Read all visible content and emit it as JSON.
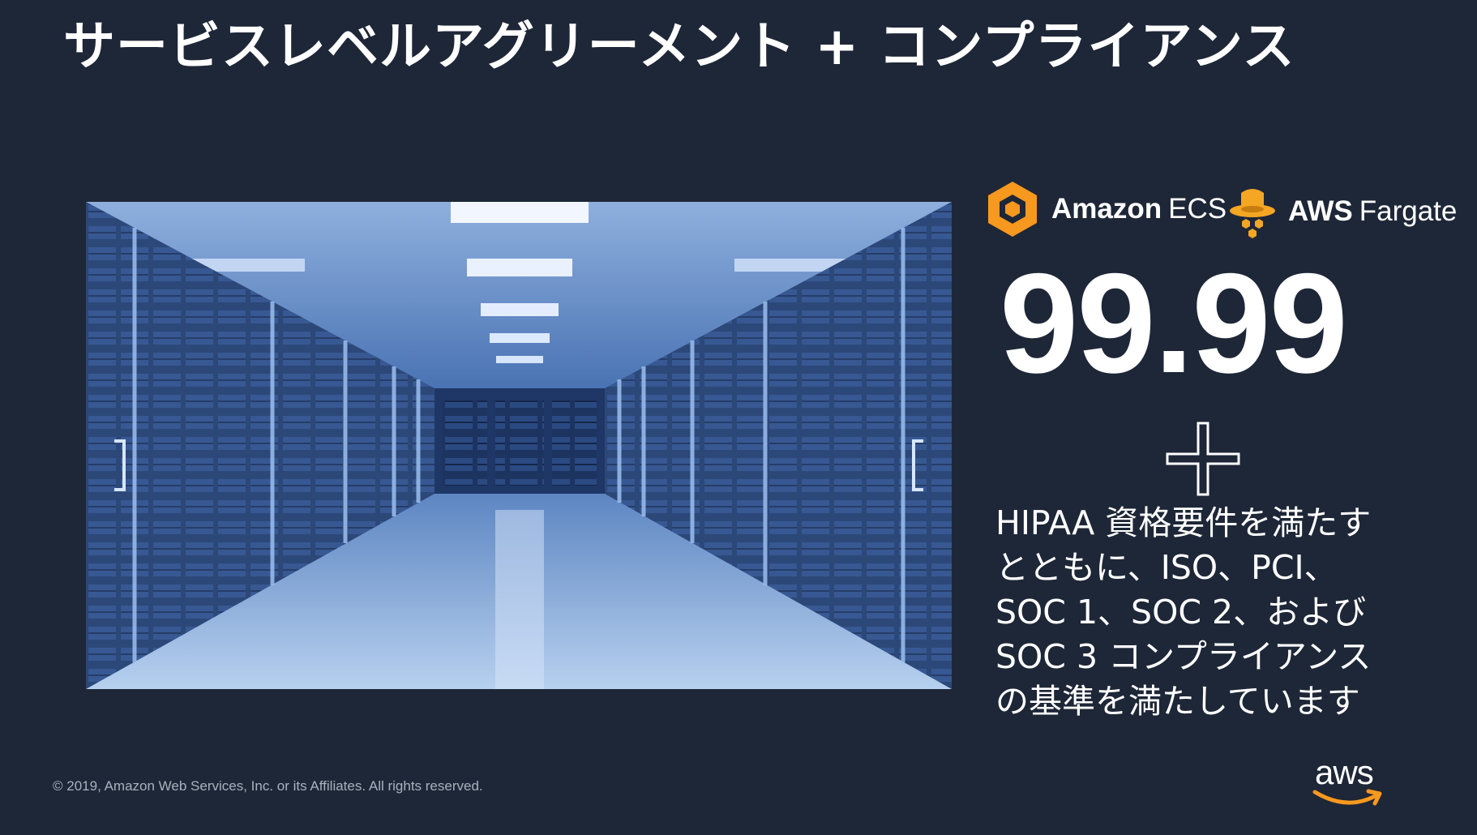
{
  "slide": {
    "title": "サービスレベルアグリーメント + コンプライアンス",
    "products": [
      {
        "name_strong": "Amazon",
        "name_light": "ECS",
        "icon": "amazon-ecs-icon"
      },
      {
        "name_strong": "AWS",
        "name_light": "Fargate",
        "icon": "aws-fargate-icon"
      }
    ],
    "sla_value": "99.99",
    "compliance_lines": [
      "HIPAA 資格要件を満たす",
      "とともに、ISO、PCI、",
      "SOC 1、SOC 2、および",
      "SOC 3 コンプライアンス",
      "の基準を満たしています"
    ],
    "copyright": "© 2019, Amazon Web Services, Inc. or its Affiliates. All rights reserved.",
    "logo_text": "aws",
    "colors": {
      "background": "#1e2737",
      "ecs_orange": "#f7981f",
      "fargate_orange": "#f5a623",
      "text": "#ffffff"
    }
  }
}
